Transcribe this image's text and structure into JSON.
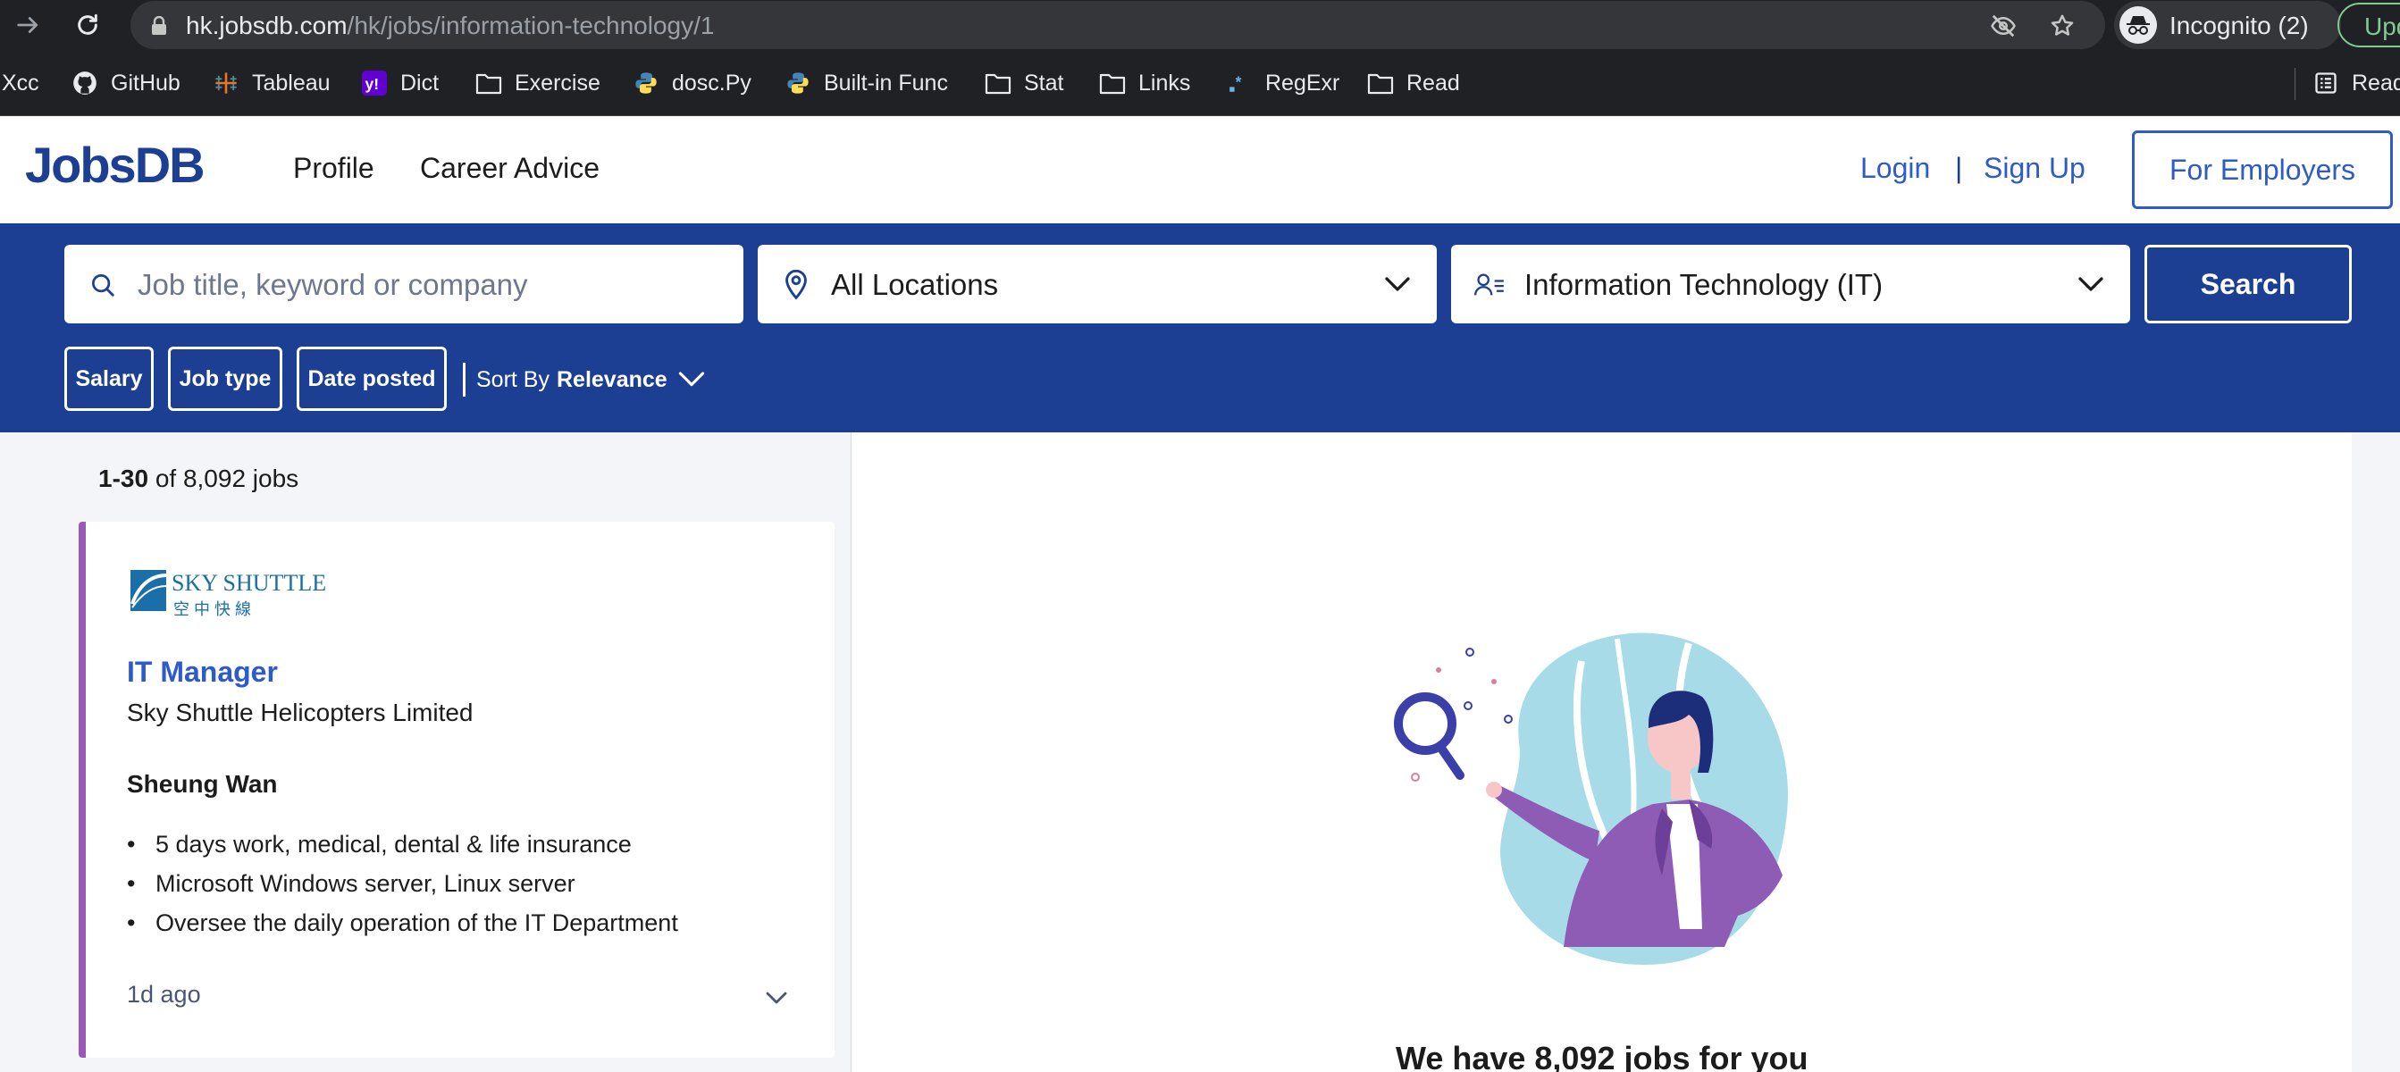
{
  "browser": {
    "url_host": "hk.jobsdb.com",
    "url_path": "/hk/jobs/information-technology/1",
    "incognito_label": "Incognito (2)",
    "update_label": "Upd",
    "bookmarks": [
      {
        "label": "Xcc",
        "icon": "none"
      },
      {
        "label": "GitHub",
        "icon": "github-icon"
      },
      {
        "label": "Tableau",
        "icon": "tableau-icon"
      },
      {
        "label": "Dict",
        "icon": "yahoo-icon"
      },
      {
        "label": "Exercise",
        "icon": "folder-icon"
      },
      {
        "label": "dosc.Py",
        "icon": "python-icon"
      },
      {
        "label": "Built-in Func",
        "icon": "python-icon"
      },
      {
        "label": "Stat",
        "icon": "folder-icon"
      },
      {
        "label": "Links",
        "icon": "folder-icon"
      },
      {
        "label": "RegExr",
        "icon": "regexr-icon"
      },
      {
        "label": "Read",
        "icon": "folder-icon"
      },
      {
        "label": "Read",
        "icon": "reading-list-icon"
      }
    ]
  },
  "header": {
    "logo": "JobsDB",
    "nav": [
      "Profile",
      "Career Advice"
    ],
    "login": "Login",
    "divider": "|",
    "signup": "Sign Up",
    "employers": "For Employers"
  },
  "search": {
    "keyword_placeholder": "Job title, keyword or company",
    "location": "All Locations",
    "classification": "Information Technology (IT)",
    "button": "Search",
    "filters": [
      "Salary",
      "Job type",
      "Date posted"
    ],
    "sort_prefix": "Sort By",
    "sort_value": "Relevance"
  },
  "results": {
    "range": "1-30",
    "of_text": "of 8,092 jobs"
  },
  "job": {
    "logo_text": "SKY SHUTTLE",
    "logo_subtext": "空 中 快 線",
    "title": "IT Manager",
    "company": "Sky Shuttle Helicopters Limited",
    "location": "Sheung Wan",
    "bullets": [
      "5 days work, medical, dental & life insurance",
      "Microsoft Windows server, Linux server",
      "Oversee the daily operation of the IT Department"
    ],
    "posted": "1d ago"
  },
  "detail": {
    "headline": "We have 8,092 jobs for you"
  },
  "colors": {
    "brand": "#1c3f94",
    "link": "#2e5bc7",
    "card_accent": "#9b59b6"
  }
}
